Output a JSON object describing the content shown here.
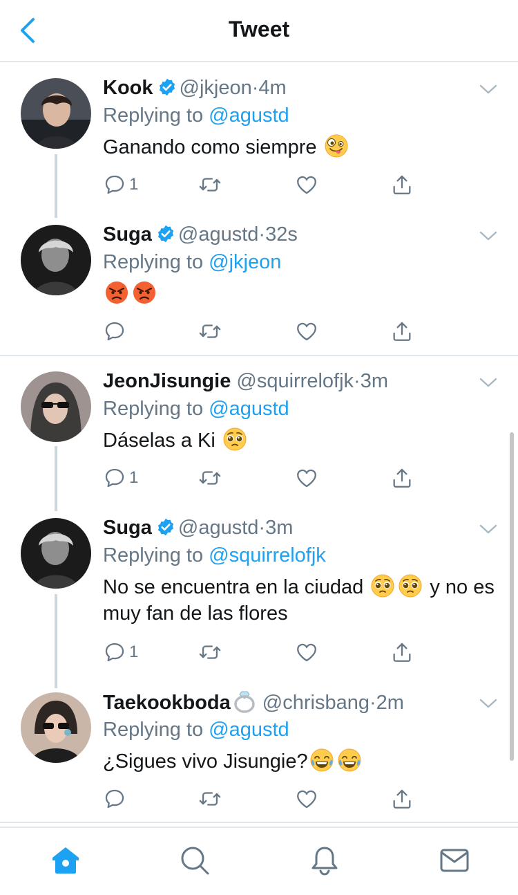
{
  "header": {
    "title": "Tweet",
    "back_icon": "chevron-left-icon"
  },
  "colors": {
    "accent": "#1da1f2",
    "text": "#14171a",
    "secondary": "#657786",
    "divider": "#e1e8ed"
  },
  "tweets": [
    {
      "name": "Kook",
      "verified": true,
      "handle": "@jkjeon",
      "dot": "·",
      "time": "4m",
      "replying_prefix": "Replying to ",
      "replying_to": "@agustd",
      "text": "Ganando como siempre ",
      "emojis": [
        "zany-face"
      ],
      "reply_count": "1",
      "retweet_count": "",
      "like_count": ""
    },
    {
      "name": "Suga",
      "verified": true,
      "handle": "@agustd",
      "dot": "·",
      "time": "32s",
      "replying_prefix": "Replying to ",
      "replying_to": "@jkjeon",
      "text": "",
      "emojis": [
        "angry-face",
        "angry-face"
      ],
      "reply_count": "",
      "retweet_count": "",
      "like_count": ""
    },
    {
      "name": "JeonJisungie",
      "verified": false,
      "handle": "@squirrelofjk",
      "dot": "·",
      "time": "3m",
      "replying_prefix": "Replying to ",
      "replying_to": "@agustd",
      "text": "Dáselas a Ki ",
      "emojis": [
        "pleading-face"
      ],
      "reply_count": "1",
      "retweet_count": "",
      "like_count": ""
    },
    {
      "name": "Suga",
      "verified": true,
      "handle": "@agustd",
      "dot": "·",
      "time": "3m",
      "replying_prefix": "Replying to ",
      "replying_to": "@squirrelofjk",
      "text_before": "No se encuentra en la ciudad ",
      "text_after": " y no es muy fan de las flores",
      "emojis": [
        "pleading-face",
        "pleading-face"
      ],
      "reply_count": "1",
      "retweet_count": "",
      "like_count": ""
    },
    {
      "name": "Taekookboda",
      "verified": false,
      "name_emoji": "ring-icon",
      "handle": "@chrisbang",
      "dot": "·",
      "time": "2m",
      "replying_prefix": "Replying to ",
      "replying_to": "@agustd",
      "text": "¿Sigues vivo Jisungie?",
      "emojis": [
        "joy-face",
        "joy-face"
      ],
      "reply_count": "",
      "retweet_count": "",
      "like_count": ""
    }
  ],
  "tabbar": {
    "items": [
      {
        "name": "home",
        "icon": "home-icon",
        "active": true
      },
      {
        "name": "search",
        "icon": "search-icon",
        "active": false
      },
      {
        "name": "notifications",
        "icon": "bell-icon",
        "active": false
      },
      {
        "name": "messages",
        "icon": "mail-icon",
        "active": false
      }
    ]
  }
}
